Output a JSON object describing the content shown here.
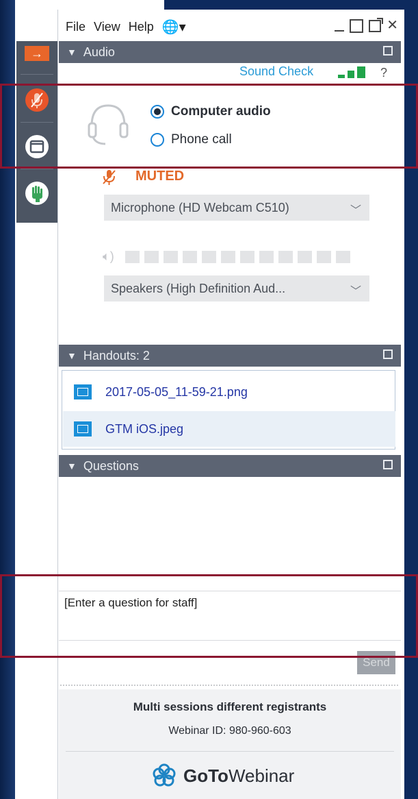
{
  "menu": {
    "file": "File",
    "view": "View",
    "help": "Help"
  },
  "audio": {
    "header": "Audio",
    "sound_check": "Sound Check",
    "help_mark": "?",
    "computer_audio": "Computer audio",
    "phone_call": "Phone call",
    "muted": "MUTED",
    "microphone": "Microphone (HD Webcam C510)",
    "speakers": "Speakers (High  Definition  Aud...",
    "selected_option": "Computer audio"
  },
  "handouts": {
    "header": "Handouts: 2",
    "files": [
      "2017-05-05_11-59-21.png",
      "GTM iOS.jpeg"
    ]
  },
  "questions": {
    "header": "Questions",
    "placeholder": "[Enter a question for staff]",
    "send": "Send"
  },
  "footer": {
    "title": "Multi sessions different registrants",
    "webinar_id": "Webinar ID: 980-960-603",
    "logo_bold": "GoTo",
    "logo_light": "Webinar"
  },
  "colors": {
    "accent": "#1a84d6",
    "muted": "#e3692a",
    "header": "#5c6473",
    "highlight": "#8b1530",
    "signal": "#21a44a"
  }
}
